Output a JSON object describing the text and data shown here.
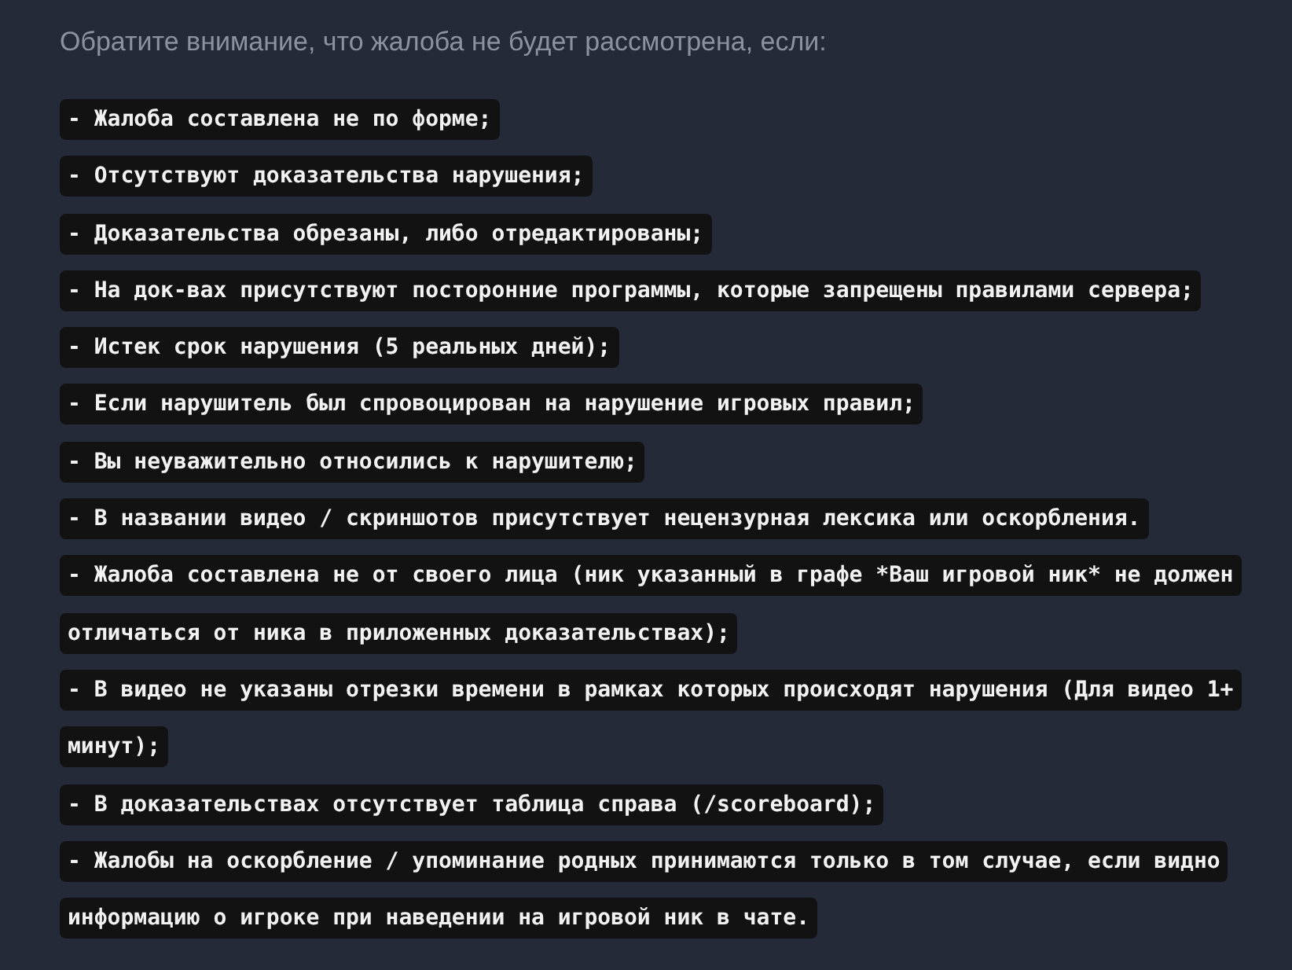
{
  "heading": "Обратите внимание, что жалоба не будет рассмотрена, если:",
  "items": [
    {
      "lines": [
        "- Жалоба составлена не по форме;"
      ]
    },
    {
      "lines": [
        "- Отсутствуют доказательства нарушения;"
      ]
    },
    {
      "lines": [
        "- Доказательства обрезаны, либо отредактированы;"
      ]
    },
    {
      "lines": [
        "- На док-вах присутствуют посторонние программы, которые запрещены правилами сервера;"
      ]
    },
    {
      "lines": [
        "- Истек срок нарушения (5 реальных дней);"
      ]
    },
    {
      "lines": [
        "- Если нарушитель был спровоцирован на нарушение игровых правил;"
      ]
    },
    {
      "lines": [
        "- Вы неуважительно относились к нарушителю;"
      ]
    },
    {
      "lines": [
        "- В названии видео / скриншотов присутствует нецензурная лексика или оскорбления."
      ]
    },
    {
      "lines": [
        "- Жалоба составлена не от своего лица (ник указанный в графе *Ваш игровой ник* не должен",
        "отличаться от ника в приложенных доказательствах);"
      ]
    },
    {
      "lines": [
        "- В видео не указаны отрезки времени в рамках которых происходят нарушения (Для видео 1+",
        "минут);"
      ]
    },
    {
      "lines": [
        "- В доказательствах отсутствует таблица справа (/scoreboard);"
      ]
    },
    {
      "lines": [
        "- Жалобы на оскорбление / упоминание родных принимаются только в том случае, если видно",
        "информацию о игроке при наведении на игровой ник в чате."
      ]
    }
  ]
}
